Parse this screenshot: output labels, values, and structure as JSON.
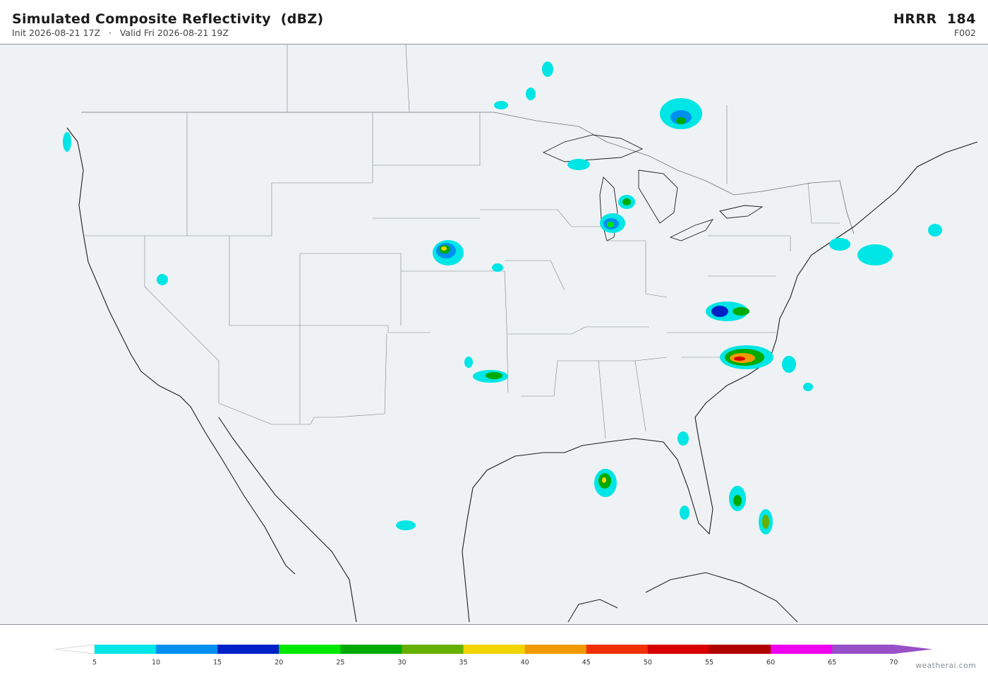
{
  "header": {
    "title": "Simulated Composite Reflectivity  (dBZ)",
    "subtitle": "Init 2026-08-21 17Z   ·   Valid Fri 2026-08-21 19Z",
    "model": "HRRR  184",
    "forecast_hour": "F002"
  },
  "legend": {
    "ticks": [
      "5",
      "10",
      "15",
      "20",
      "25",
      "30",
      "35",
      "40",
      "45",
      "50",
      "55",
      "60",
      "65",
      "70"
    ],
    "colors": [
      "#00e5e5",
      "#0090f0",
      "#0020c8",
      "#00e800",
      "#00aa00",
      "#66b000",
      "#f2d500",
      "#f09a00",
      "#f03000",
      "#d80000",
      "#b00000",
      "#f000f0",
      "#9850c8"
    ]
  },
  "credit": "weatherai.com"
}
